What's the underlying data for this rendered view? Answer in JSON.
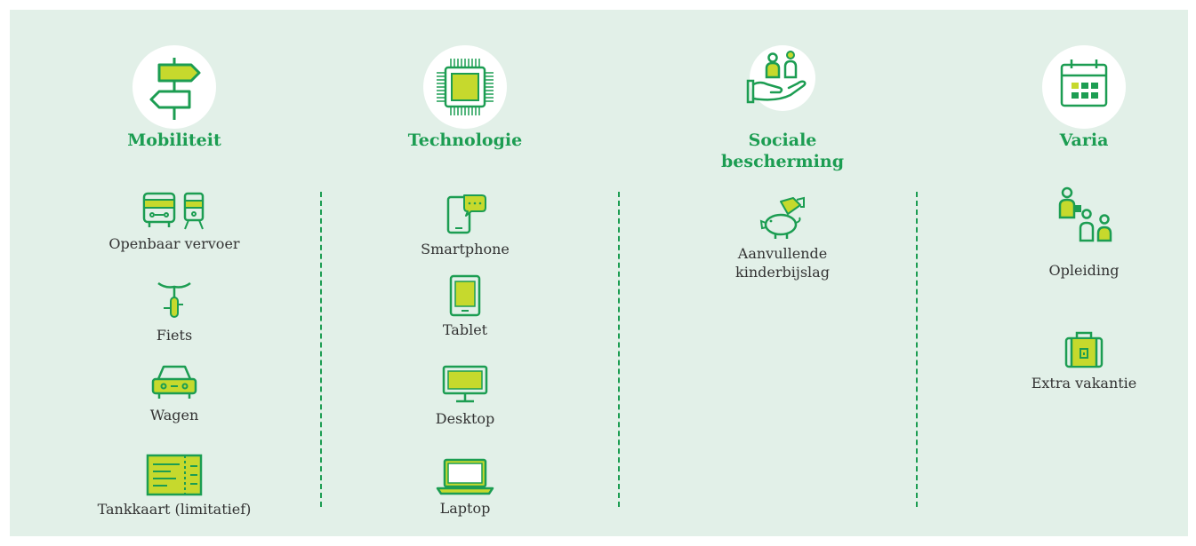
{
  "colors": {
    "background": "#e2f0e8",
    "accent": "#1c9d52",
    "fill": "#c6d92d",
    "text": "#333333"
  },
  "categories": [
    {
      "title": "Mobiliteit",
      "icon": "signpost-icon",
      "items": [
        {
          "label": "Openbaar vervoer",
          "icon": "bus-train-icon"
        },
        {
          "label": "Fiets",
          "icon": "bicycle-icon"
        },
        {
          "label": "Wagen",
          "icon": "car-icon"
        },
        {
          "label": "Tankkaart (limitatief)",
          "icon": "fuel-card-icon"
        }
      ]
    },
    {
      "title": "Technologie",
      "icon": "chip-icon",
      "items": [
        {
          "label": "Smartphone",
          "icon": "smartphone-icon"
        },
        {
          "label": "Tablet",
          "icon": "tablet-icon"
        },
        {
          "label": "Desktop",
          "icon": "desktop-icon"
        },
        {
          "label": "Laptop",
          "icon": "laptop-icon"
        }
      ]
    },
    {
      "title": "Sociale bescherming",
      "icon": "family-hand-icon",
      "items": [
        {
          "label": "Aanvullende kinderbijslag",
          "icon": "piggy-bank-icon"
        }
      ]
    },
    {
      "title": "Varia",
      "icon": "calendar-icon",
      "items": [
        {
          "label": "Opleiding",
          "icon": "training-icon"
        },
        {
          "label": "Extra vakantie",
          "icon": "suitcase-icon"
        }
      ]
    }
  ]
}
